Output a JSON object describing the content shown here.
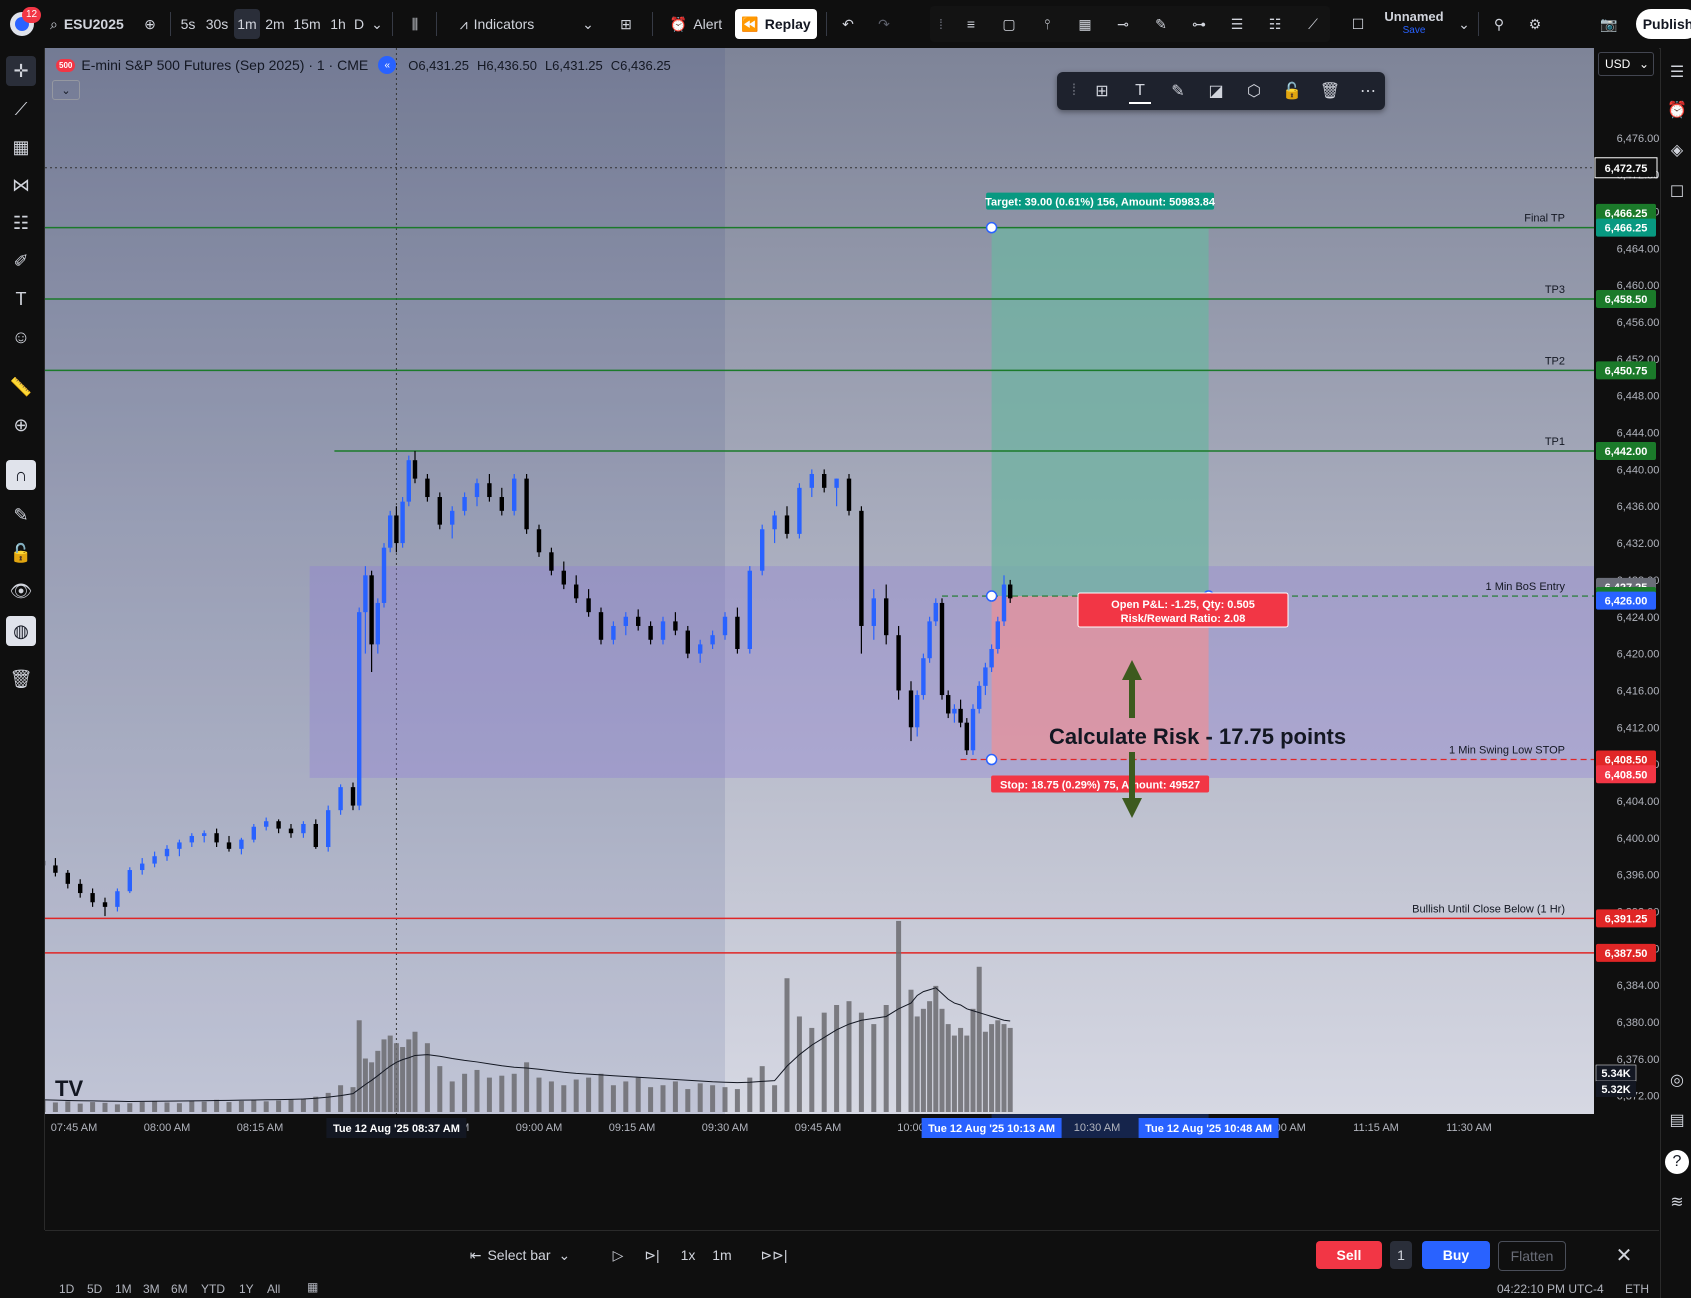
{
  "topbar": {
    "notification_count": "12",
    "symbol": "ESU2025",
    "intervals": [
      "5s",
      "30s",
      "1m",
      "2m",
      "15m",
      "1h",
      "D"
    ],
    "active_interval": "1m",
    "indicators_label": "Indicators",
    "alert_label": "Alert",
    "replay_label": "Replay",
    "layout_name": "Unnamed",
    "layout_status": "Save",
    "publish_label": "Publish"
  },
  "legend": {
    "title": "E-mini S&P 500 Futures (Sep 2025) · 1 · CME",
    "open": "O6,431.25",
    "high": "H6,436.50",
    "low": "L6,431.25",
    "close": "C6,436.25",
    "badge": "500"
  },
  "currency": "USD",
  "bottombar": {
    "select_bar_label": "Select bar",
    "speed": "1x",
    "interval": "1m",
    "sell_label": "Sell",
    "quantity": "1",
    "buy_label": "Buy",
    "flatten_label": "Flatten"
  },
  "footer": {
    "ranges": [
      "1D",
      "5D",
      "1M",
      "3M",
      "6M",
      "YTD",
      "1Y",
      "All"
    ],
    "clock": "04:22:10 PM UTC-4",
    "session": "ETH"
  },
  "colors": {
    "accent": "#2962ff",
    "up": "#2962ff",
    "down": "#000000",
    "tp_line": "#1b7a2a",
    "stop_line": "#e02626",
    "profit_zone": "#6fb3a1",
    "loss_zone": "#e8919a"
  },
  "chart_data": {
    "type": "candlestick",
    "symbol": "ESU2025",
    "interval": "1m",
    "ylim": [
      6370,
      6484
    ],
    "y_ticks": [
      6372,
      6376,
      6380,
      6384,
      6388,
      6392,
      6396,
      6400,
      6404,
      6408,
      6412,
      6416,
      6420,
      6424,
      6428,
      6432,
      6436,
      6440,
      6444,
      6448,
      6452,
      6456,
      6460,
      6464,
      6468,
      6472,
      6476,
      6480
    ],
    "y_tick_labels": [
      "6,372.00",
      "6,376.00",
      "6,380.00",
      "6,384.00",
      "6,388.00",
      "6,392.00",
      "6,396.00",
      "6,400.00",
      "6,404.00",
      "6,408.00",
      "6,412.00",
      "6,416.00",
      "6,420.00",
      "6,424.00",
      "6,428.00",
      "6,432.00",
      "6,436.00",
      "6,440.00",
      "6,444.00",
      "6,448.00",
      "6,452.00",
      "6,456.00",
      "6,460.00",
      "6,464.00",
      "6,468.00",
      "6,472.00",
      "6,476.00",
      "6,480.00"
    ],
    "x_start": "07:40",
    "x_end": "11:39",
    "x_ticks": [
      "07:45",
      "08:00",
      "08:15",
      "08:30",
      "08:45",
      "09:00",
      "09:15",
      "09:30",
      "09:45",
      "10:00",
      "10:15",
      "10:30",
      "10:45",
      "11:00",
      "11:15",
      "11:30"
    ],
    "x_tick_labels": [
      "07:45 AM",
      "08:00 AM",
      "08:15 AM",
      "08:30 AM",
      "08:45 AM",
      "09:00 AM",
      "09:15 AM",
      "09:30 AM",
      "09:45 AM",
      "10:00",
      "10:15 AM",
      "10:30 AM",
      "10:45 AM",
      "11:00 AM",
      "11:15 AM",
      "11:30 AM"
    ],
    "crosshair_labels": [
      {
        "time": "08:37",
        "text": "Tue 12 Aug '25   08:37 AM"
      },
      {
        "time": "10:13",
        "text": "Tue 12 Aug '25   10:13 AM"
      },
      {
        "time": "10:48",
        "text": "Tue 12 Aug '25   10:48 AM"
      }
    ],
    "crosshair_price": {
      "price": 6472.75,
      "label": "6,472.75"
    },
    "session_start": "09:30",
    "horizontal_lines": [
      {
        "name": "Final TP",
        "price": 6466.25,
        "label": "6,466.25",
        "color": "#1b7a2a"
      },
      {
        "name": "TP3",
        "price": 6458.5,
        "label": "6,458.50",
        "color": "#1b7a2a"
      },
      {
        "name": "TP2",
        "price": 6450.75,
        "label": "6,450.75",
        "color": "#1b7a2a"
      },
      {
        "name": "TP1",
        "price": 6442.0,
        "label": "6,442.00",
        "color": "#1b7a2a",
        "from": "08:27"
      },
      {
        "name": "Bullish Until Close Below (1 Hr)",
        "price": 6391.25,
        "label": "6,391.25",
        "color": "#e02626"
      },
      {
        "name": "",
        "price": 6387.5,
        "label": "6,387.50",
        "color": "#e02626"
      }
    ],
    "range_box": {
      "from": "08:23",
      "to": "11:39",
      "top": 6429.5,
      "bottom": 6406.5
    },
    "position": {
      "entry_name": "1 Min BoS Entry",
      "entry": 6426.25,
      "entry_label": "6,426.25",
      "target": 6466.25,
      "target_label": "6,466.25",
      "stop": 6408.5,
      "stop_label": "6,408.50",
      "current_label": "6,426.00",
      "current": 6426.0,
      "from": "10:13",
      "to": "10:48",
      "target_text": "Target: 39.00 (0.61%) 156, Amount: 50983.84",
      "stop_text": "Stop: 18.75 (0.29%) 75, Amount: 49527",
      "info_line1": "Open P&L: -1.25, Qty: 0.505",
      "info_line2": "Risk/Reward Ratio: 2.08",
      "high_label": "6,427.25",
      "high": 6427.25,
      "stop_line_name": "1 Min Swing Low STOP",
      "stop_tag_label": "6,408.50"
    },
    "annotation": {
      "text": "Calculate Risk - 17.75 points",
      "price": 6416.5,
      "time": "10:11"
    },
    "volume_labels": [
      "5.34K",
      "5.32K"
    ],
    "candles": [
      {
        "t": "07:40",
        "o": 6397.5,
        "h": 6398.0,
        "l": 6396.5,
        "c": 6397.0
      },
      {
        "t": "07:42",
        "o": 6397.0,
        "h": 6397.8,
        "l": 6395.8,
        "c": 6396.2
      },
      {
        "t": "07:44",
        "o": 6396.2,
        "h": 6396.5,
        "l": 6394.5,
        "c": 6395.0
      },
      {
        "t": "07:46",
        "o": 6395.0,
        "h": 6395.5,
        "l": 6393.5,
        "c": 6394.0
      },
      {
        "t": "07:48",
        "o": 6394.0,
        "h": 6394.5,
        "l": 6392.5,
        "c": 6393.0
      },
      {
        "t": "07:50",
        "o": 6393.0,
        "h": 6393.5,
        "l": 6391.5,
        "c": 6392.5
      },
      {
        "t": "07:52",
        "o": 6392.5,
        "h": 6394.5,
        "l": 6392.0,
        "c": 6394.2
      },
      {
        "t": "07:54",
        "o": 6394.2,
        "h": 6396.8,
        "l": 6394.0,
        "c": 6396.5
      },
      {
        "t": "07:56",
        "o": 6396.5,
        "h": 6397.8,
        "l": 6396.0,
        "c": 6397.2
      },
      {
        "t": "07:58",
        "o": 6397.2,
        "h": 6398.5,
        "l": 6396.8,
        "c": 6398.0
      },
      {
        "t": "08:00",
        "o": 6398.0,
        "h": 6399.2,
        "l": 6397.5,
        "c": 6398.8
      },
      {
        "t": "08:02",
        "o": 6398.8,
        "h": 6399.8,
        "l": 6398.0,
        "c": 6399.5
      },
      {
        "t": "08:04",
        "o": 6399.5,
        "h": 6400.5,
        "l": 6399.0,
        "c": 6400.2
      },
      {
        "t": "08:06",
        "o": 6400.2,
        "h": 6400.8,
        "l": 6399.5,
        "c": 6400.5
      },
      {
        "t": "08:08",
        "o": 6400.5,
        "h": 6401.0,
        "l": 6399.0,
        "c": 6399.5
      },
      {
        "t": "08:10",
        "o": 6399.5,
        "h": 6400.2,
        "l": 6398.5,
        "c": 6398.8
      },
      {
        "t": "08:12",
        "o": 6398.8,
        "h": 6400.0,
        "l": 6398.2,
        "c": 6399.8
      },
      {
        "t": "08:14",
        "o": 6399.8,
        "h": 6401.5,
        "l": 6399.5,
        "c": 6401.2
      },
      {
        "t": "08:16",
        "o": 6401.2,
        "h": 6402.2,
        "l": 6400.8,
        "c": 6401.8
      },
      {
        "t": "08:18",
        "o": 6401.8,
        "h": 6402.0,
        "l": 6400.5,
        "c": 6401.0
      },
      {
        "t": "08:20",
        "o": 6401.0,
        "h": 6401.5,
        "l": 6400.0,
        "c": 6400.5
      },
      {
        "t": "08:22",
        "o": 6400.5,
        "h": 6401.8,
        "l": 6400.0,
        "c": 6401.5
      },
      {
        "t": "08:24",
        "o": 6401.5,
        "h": 6402.0,
        "l": 6398.8,
        "c": 6399.0
      },
      {
        "t": "08:26",
        "o": 6399.0,
        "h": 6403.5,
        "l": 6398.5,
        "c": 6403.0
      },
      {
        "t": "08:28",
        "o": 6403.0,
        "h": 6405.8,
        "l": 6402.5,
        "c": 6405.5
      },
      {
        "t": "08:30",
        "o": 6405.5,
        "h": 6406.0,
        "l": 6403.0,
        "c": 6403.5
      },
      {
        "t": "08:31",
        "o": 6403.5,
        "h": 6425.0,
        "l": 6403.0,
        "c": 6424.5
      },
      {
        "t": "08:32",
        "o": 6424.5,
        "h": 6429.5,
        "l": 6420.0,
        "c": 6428.5
      },
      {
        "t": "08:33",
        "o": 6428.5,
        "h": 6429.0,
        "l": 6418.0,
        "c": 6421.0
      },
      {
        "t": "08:34",
        "o": 6421.0,
        "h": 6426.0,
        "l": 6420.0,
        "c": 6425.5
      },
      {
        "t": "08:35",
        "o": 6425.5,
        "h": 6432.0,
        "l": 6425.0,
        "c": 6431.5
      },
      {
        "t": "08:36",
        "o": 6431.5,
        "h": 6435.5,
        "l": 6431.0,
        "c": 6435.0
      },
      {
        "t": "08:37",
        "o": 6435.0,
        "h": 6436.0,
        "l": 6431.0,
        "c": 6432.0
      },
      {
        "t": "08:38",
        "o": 6432.0,
        "h": 6437.0,
        "l": 6431.5,
        "c": 6436.5
      },
      {
        "t": "08:39",
        "o": 6436.5,
        "h": 6441.5,
        "l": 6436.0,
        "c": 6441.0
      },
      {
        "t": "08:40",
        "o": 6441.0,
        "h": 6442.0,
        "l": 6438.5,
        "c": 6439.0
      },
      {
        "t": "08:42",
        "o": 6439.0,
        "h": 6439.5,
        "l": 6436.5,
        "c": 6437.0
      },
      {
        "t": "08:44",
        "o": 6437.0,
        "h": 6437.5,
        "l": 6433.5,
        "c": 6434.0
      },
      {
        "t": "08:46",
        "o": 6434.0,
        "h": 6436.0,
        "l": 6432.5,
        "c": 6435.5
      },
      {
        "t": "08:48",
        "o": 6435.5,
        "h": 6437.5,
        "l": 6435.0,
        "c": 6437.0
      },
      {
        "t": "08:50",
        "o": 6437.0,
        "h": 6439.0,
        "l": 6436.0,
        "c": 6438.5
      },
      {
        "t": "08:52",
        "o": 6438.5,
        "h": 6439.5,
        "l": 6436.5,
        "c": 6437.0
      },
      {
        "t": "08:54",
        "o": 6437.0,
        "h": 6438.0,
        "l": 6435.0,
        "c": 6435.5
      },
      {
        "t": "08:56",
        "o": 6435.5,
        "h": 6439.5,
        "l": 6435.0,
        "c": 6439.0
      },
      {
        "t": "08:58",
        "o": 6439.0,
        "h": 6439.5,
        "l": 6433.0,
        "c": 6433.5
      },
      {
        "t": "09:00",
        "o": 6433.5,
        "h": 6434.0,
        "l": 6430.5,
        "c": 6431.0
      },
      {
        "t": "09:02",
        "o": 6431.0,
        "h": 6431.5,
        "l": 6428.5,
        "c": 6429.0
      },
      {
        "t": "09:04",
        "o": 6429.0,
        "h": 6430.0,
        "l": 6427.0,
        "c": 6427.5
      },
      {
        "t": "09:06",
        "o": 6427.5,
        "h": 6428.5,
        "l": 6425.5,
        "c": 6426.0
      },
      {
        "t": "09:08",
        "o": 6426.0,
        "h": 6427.0,
        "l": 6424.0,
        "c": 6424.5
      },
      {
        "t": "09:10",
        "o": 6424.5,
        "h": 6425.0,
        "l": 6421.0,
        "c": 6421.5
      },
      {
        "t": "09:12",
        "o": 6421.5,
        "h": 6423.5,
        "l": 6421.0,
        "c": 6423.0
      },
      {
        "t": "09:14",
        "o": 6423.0,
        "h": 6424.5,
        "l": 6422.0,
        "c": 6424.0
      },
      {
        "t": "09:16",
        "o": 6424.0,
        "h": 6424.8,
        "l": 6422.5,
        "c": 6423.0
      },
      {
        "t": "09:18",
        "o": 6423.0,
        "h": 6423.5,
        "l": 6421.0,
        "c": 6421.5
      },
      {
        "t": "09:20",
        "o": 6421.5,
        "h": 6424.0,
        "l": 6421.0,
        "c": 6423.5
      },
      {
        "t": "09:22",
        "o": 6423.5,
        "h": 6424.5,
        "l": 6422.0,
        "c": 6422.5
      },
      {
        "t": "09:24",
        "o": 6422.5,
        "h": 6423.0,
        "l": 6419.5,
        "c": 6420.0
      },
      {
        "t": "09:26",
        "o": 6420.0,
        "h": 6421.5,
        "l": 6419.0,
        "c": 6421.0
      },
      {
        "t": "09:28",
        "o": 6421.0,
        "h": 6422.5,
        "l": 6420.5,
        "c": 6422.0
      },
      {
        "t": "09:30",
        "o": 6422.0,
        "h": 6424.5,
        "l": 6421.5,
        "c": 6424.0
      },
      {
        "t": "09:32",
        "o": 6424.0,
        "h": 6425.0,
        "l": 6420.0,
        "c": 6420.5
      },
      {
        "t": "09:34",
        "o": 6420.5,
        "h": 6429.5,
        "l": 6420.0,
        "c": 6429.0
      },
      {
        "t": "09:36",
        "o": 6429.0,
        "h": 6434.0,
        "l": 6428.5,
        "c": 6433.5
      },
      {
        "t": "09:38",
        "o": 6433.5,
        "h": 6435.5,
        "l": 6432.0,
        "c": 6435.0
      },
      {
        "t": "09:40",
        "o": 6435.0,
        "h": 6436.0,
        "l": 6432.5,
        "c": 6433.0
      },
      {
        "t": "09:42",
        "o": 6433.0,
        "h": 6438.5,
        "l": 6432.5,
        "c": 6438.0
      },
      {
        "t": "09:44",
        "o": 6438.0,
        "h": 6440.0,
        "l": 6437.0,
        "c": 6439.5
      },
      {
        "t": "09:46",
        "o": 6439.5,
        "h": 6440.0,
        "l": 6437.5,
        "c": 6438.0
      },
      {
        "t": "09:48",
        "o": 6438.0,
        "h": 6439.0,
        "l": 6436.0,
        "c": 6439.0
      },
      {
        "t": "09:50",
        "o": 6439.0,
        "h": 6439.5,
        "l": 6435.0,
        "c": 6435.5
      },
      {
        "t": "09:52",
        "o": 6435.5,
        "h": 6436.0,
        "l": 6420.0,
        "c": 6423.0
      },
      {
        "t": "09:54",
        "o": 6423.0,
        "h": 6427.0,
        "l": 6421.5,
        "c": 6426.0
      },
      {
        "t": "09:56",
        "o": 6426.0,
        "h": 6427.5,
        "l": 6421.0,
        "c": 6422.0
      },
      {
        "t": "09:58",
        "o": 6422.0,
        "h": 6423.0,
        "l": 6415.0,
        "c": 6416.0
      },
      {
        "t": "10:00",
        "o": 6416.0,
        "h": 6417.0,
        "l": 6410.5,
        "c": 6412.0
      },
      {
        "t": "10:01",
        "o": 6412.0,
        "h": 6416.0,
        "l": 6411.0,
        "c": 6415.5
      },
      {
        "t": "10:02",
        "o": 6415.5,
        "h": 6420.0,
        "l": 6415.0,
        "c": 6419.5
      },
      {
        "t": "10:03",
        "o": 6419.5,
        "h": 6424.0,
        "l": 6419.0,
        "c": 6423.5
      },
      {
        "t": "10:04",
        "o": 6423.5,
        "h": 6426.0,
        "l": 6423.0,
        "c": 6425.5
      },
      {
        "t": "10:05",
        "o": 6425.5,
        "h": 6426.0,
        "l": 6415.0,
        "c": 6415.5
      },
      {
        "t": "10:06",
        "o": 6415.5,
        "h": 6416.0,
        "l": 6413.0,
        "c": 6413.5
      },
      {
        "t": "10:07",
        "o": 6413.5,
        "h": 6414.5,
        "l": 6412.5,
        "c": 6414.0
      },
      {
        "t": "10:08",
        "o": 6414.0,
        "h": 6415.0,
        "l": 6412.0,
        "c": 6412.5
      },
      {
        "t": "10:09",
        "o": 6412.5,
        "h": 6413.0,
        "l": 6409.0,
        "c": 6409.5
      },
      {
        "t": "10:10",
        "o": 6409.5,
        "h": 6414.5,
        "l": 6409.0,
        "c": 6414.0
      },
      {
        "t": "10:11",
        "o": 6414.0,
        "h": 6417.0,
        "l": 6413.5,
        "c": 6416.5
      },
      {
        "t": "10:12",
        "o": 6416.5,
        "h": 6419.0,
        "l": 6415.5,
        "c": 6418.5
      },
      {
        "t": "10:13",
        "o": 6418.5,
        "h": 6421.0,
        "l": 6418.0,
        "c": 6420.5
      },
      {
        "t": "10:14",
        "o": 6420.5,
        "h": 6424.0,
        "l": 6420.0,
        "c": 6423.5
      },
      {
        "t": "10:15",
        "o": 6423.5,
        "h": 6428.5,
        "l": 6423.0,
        "c": 6427.5
      },
      {
        "t": "10:16",
        "o": 6427.5,
        "h": 6428.0,
        "l": 6425.5,
        "c": 6426.0
      }
    ],
    "volume": {
      "ylim": [
        0,
        5600
      ],
      "bars": [
        300,
        250,
        280,
        220,
        260,
        240,
        200,
        230,
        260,
        280,
        250,
        230,
        300,
        270,
        320,
        260,
        290,
        310,
        280,
        300,
        330,
        350,
        400,
        500,
        700,
        650,
        2400,
        1400,
        1300,
        1600,
        1900,
        2000,
        1800,
        1700,
        1900,
        2100,
        1800,
        1200,
        800,
        1000,
        1100,
        900,
        950,
        1000,
        1300,
        900,
        800,
        700,
        850,
        900,
        1000,
        700,
        800,
        900,
        650,
        700,
        800,
        600,
        750,
        700,
        650,
        600,
        900,
        1200,
        700,
        3500,
        2500,
        2200,
        2600,
        2800,
        2900,
        2600,
        2300,
        2800,
        5000,
        3200,
        2500,
        2700,
        2900,
        3300,
        2700,
        2300,
        2000,
        2200,
        2000,
        2700,
        3800,
        2100,
        2300,
        2400,
        2300,
        2200,
        2100,
        2200
      ],
      "ma": [
        320,
        310,
        300,
        295,
        290,
        285,
        280,
        275,
        278,
        282,
        285,
        288,
        292,
        295,
        300,
        305,
        310,
        315,
        320,
        325,
        330,
        340,
        360,
        390,
        430,
        480,
        600,
        720,
        830,
        950,
        1080,
        1200,
        1300,
        1370,
        1420,
        1480,
        1500,
        1460,
        1400,
        1350,
        1310,
        1260,
        1210,
        1170,
        1150,
        1120,
        1080,
        1040,
        1010,
        990,
        970,
        950,
        930,
        910,
        890,
        870,
        850,
        830,
        810,
        790,
        780,
        770,
        780,
        800,
        820,
        1200,
        1500,
        1750,
        1950,
        2150,
        2300,
        2400,
        2450,
        2500,
        2700,
        2850,
        3050,
        3150,
        3200,
        3250,
        3100,
        2950,
        2850,
        2800,
        2700,
        2650,
        2600,
        2550,
        2500,
        2450,
        2400,
        2380,
        2350,
        2350
      ]
    }
  }
}
